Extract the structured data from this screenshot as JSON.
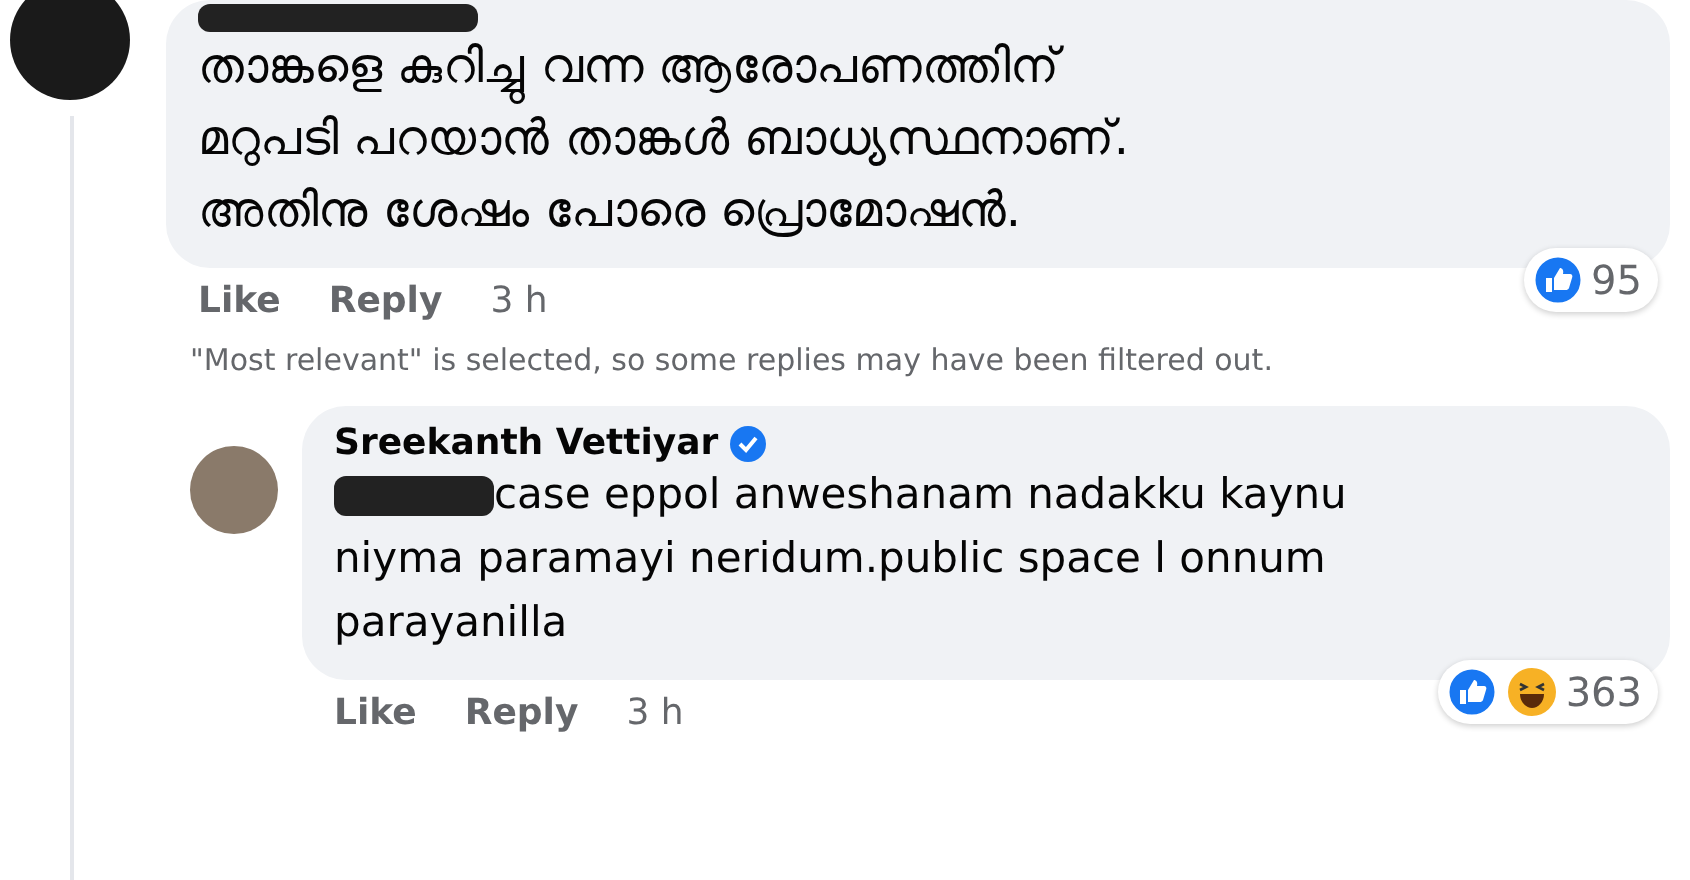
{
  "comments": [
    {
      "author_redacted": true,
      "verified": false,
      "body": [
        "താങ്കളെ കുറിച്ചു വന്ന ആരോപണത്തിന്",
        "മറുപടി പറയാൻ താങ്കൾ ബാധ്യസ്ഥനാണ്.",
        "അതിനു ശേഷം പോരെ പ്രൊമോഷൻ."
      ],
      "body_redacted_prefix": false,
      "reactions": [
        {
          "kind": "like"
        }
      ],
      "reaction_count": "95",
      "actions": [
        "Like",
        "Reply",
        "3 h"
      ]
    },
    {
      "author_redacted": false,
      "author": "Sreekanth Vettiyar",
      "verified": true,
      "body": [
        "case eppol anweshanam nadakku kaynu",
        "niyma paramayi neridum.public space l onnum",
        "parayanilla"
      ],
      "body_redacted_prefix": true,
      "reactions": [
        {
          "kind": "like"
        },
        {
          "kind": "haha"
        }
      ],
      "reaction_count": "363",
      "actions": [
        "Like",
        "Reply",
        "3 h"
      ]
    }
  ],
  "filter_notice": "\"Most relevant\" is selected, so some replies may have been filtered out."
}
